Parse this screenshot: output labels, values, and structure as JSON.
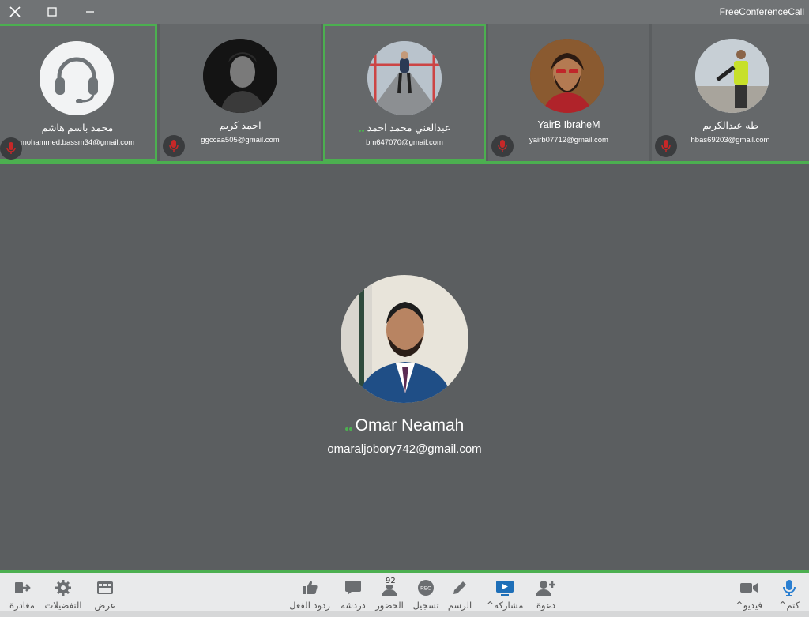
{
  "window": {
    "app_title": "FreeConferenceCall"
  },
  "participants": [
    {
      "name": "محمد باسم هاشم",
      "email": "mohammed.bassm34@gmail.com",
      "muted": true,
      "speaking": false,
      "active": true
    },
    {
      "name": "احمد كريم",
      "email": "ggccaa505@gmail.com",
      "muted": true,
      "speaking": false,
      "active": false
    },
    {
      "name": "عبدالغني محمد احمد",
      "email": "bm647070@gmail.com",
      "muted": false,
      "speaking": true,
      "active": true
    },
    {
      "name": "YairB IbraheM",
      "email": "yairb07712@gmail.com",
      "muted": true,
      "speaking": false,
      "active": false
    },
    {
      "name": "طه عبدالكريم",
      "email": "hbas69203@gmail.com",
      "muted": true,
      "speaking": false,
      "active": false
    }
  ],
  "speaker": {
    "name": "Omar Neamah",
    "email": "omaraljobory742@gmail.com"
  },
  "toolbar": {
    "leave": "مغادرة",
    "settings": "التفضيلات",
    "view": "عرض",
    "reactions": "ردود الفعل",
    "chat": "دردشة",
    "attendance": "الحضور",
    "attendance_count": "92",
    "record": "تسجيل",
    "draw": "الرسم",
    "share": "مشاركة",
    "invite": "دعوة",
    "video": "فيديو",
    "mute": "كتم"
  },
  "colors": {
    "accent": "#4caf50",
    "mute_red": "#c62828",
    "icon_gray": "#6b6e71",
    "share_blue": "#1e6fb8",
    "mic_blue": "#2a7fd1"
  }
}
